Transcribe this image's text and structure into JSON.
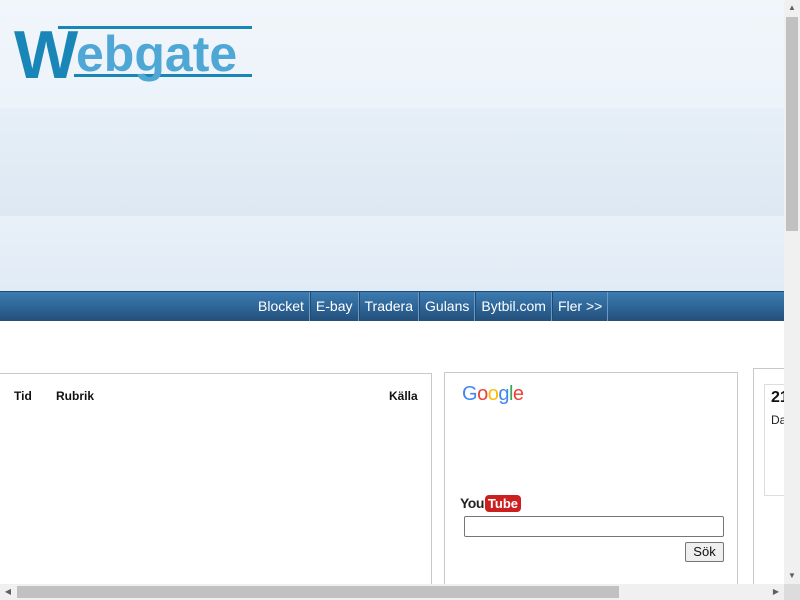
{
  "header": {
    "logo_w": "W",
    "logo_rest": "ebgate"
  },
  "nav": {
    "items": [
      "Blocket",
      "E-bay",
      "Tradera",
      "Gulans",
      "Bytbil.com",
      "Fler >>"
    ]
  },
  "news": {
    "columns": {
      "time": "Tid",
      "headline": "Rubrik",
      "source": "Källa"
    }
  },
  "search": {
    "google_letters": [
      {
        "ch": "G",
        "color": "#4285F4"
      },
      {
        "ch": "o",
        "color": "#EA4335"
      },
      {
        "ch": "o",
        "color": "#FBBC05"
      },
      {
        "ch": "g",
        "color": "#4285F4"
      },
      {
        "ch": "l",
        "color": "#34A853"
      },
      {
        "ch": "e",
        "color": "#EA4335"
      }
    ],
    "youtube_you": "You",
    "youtube_tube": "Tube",
    "input_value": "",
    "button_label": "Sök"
  },
  "side": {
    "date_number": "21",
    "date_day": "Da"
  },
  "colors": {
    "navbar": "#2d6496",
    "logo_dark": "#1a86b8",
    "logo_light": "#4ea7d4"
  }
}
